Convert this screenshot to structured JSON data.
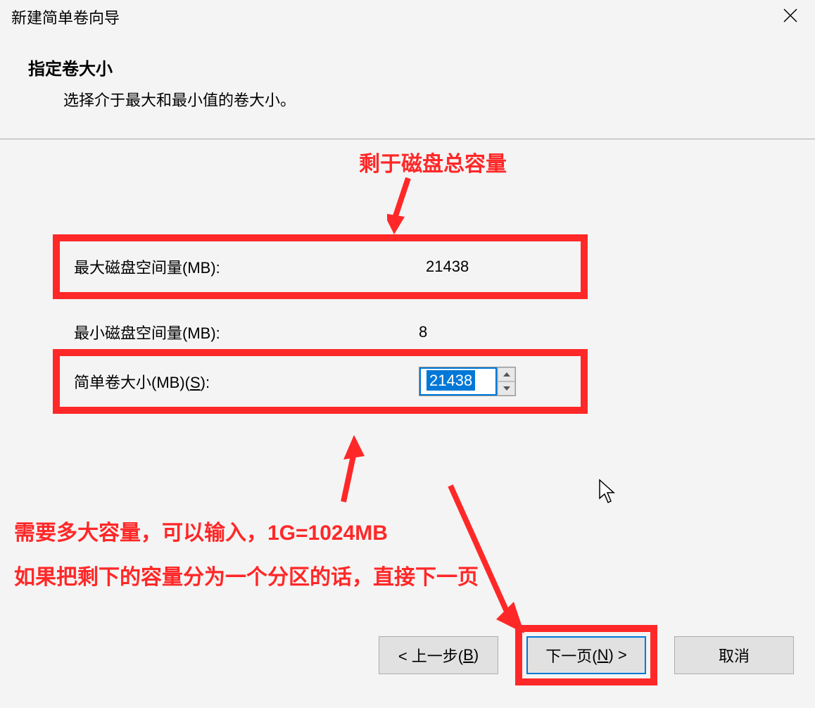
{
  "titlebar": {
    "title": "新建简单卷向导"
  },
  "header": {
    "title": "指定卷大小",
    "subtitle": "选择介于最大和最小值的卷大小。"
  },
  "rows": {
    "max_space_label": "最大磁盘空间量(MB):",
    "max_space_value": "21438",
    "min_space_label": "最小磁盘空间量(MB):",
    "min_space_value": "8",
    "simple_volume_label_prefix": "简单卷大小(MB)(",
    "simple_volume_key": "S",
    "simple_volume_label_suffix": "):",
    "simple_volume_value": "21438"
  },
  "annotations": {
    "top": "剩于磁盘总容量",
    "bottom_line1": "需要多大容量，可以输入，1G=1024MB",
    "bottom_line2": "如果把剩下的容量分为一个分区的话，直接下一页"
  },
  "buttons": {
    "back_prefix": "< 上一步(",
    "back_key": "B",
    "back_suffix": ")",
    "next_prefix": "下一页(",
    "next_key": "N",
    "next_suffix": ") >",
    "cancel": "取消"
  }
}
